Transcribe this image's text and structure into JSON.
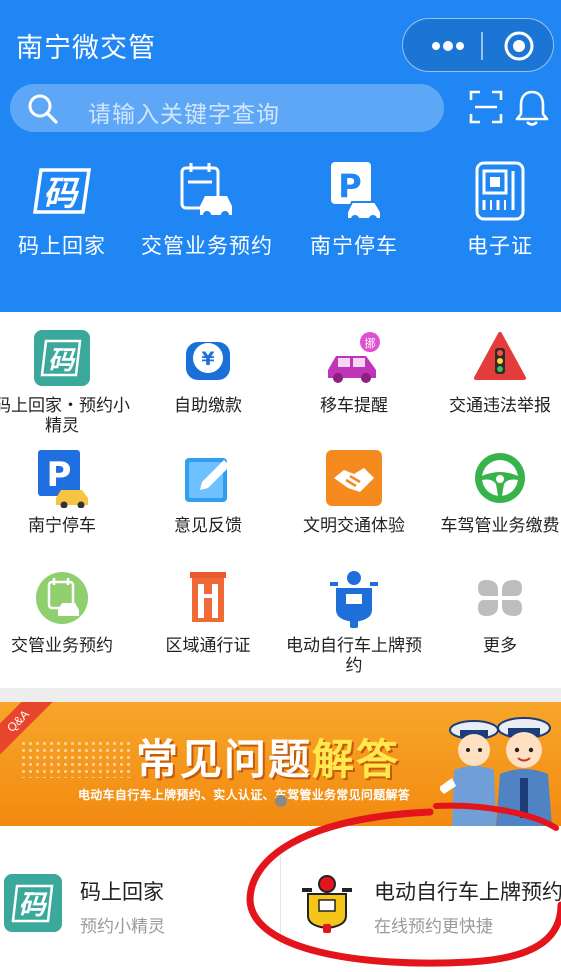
{
  "header": {
    "title": "南宁微交管",
    "search_placeholder": "请输入关键字查询",
    "menu_icon": "more-dots-icon",
    "close_icon": "target-circle-icon"
  },
  "quick_actions": [
    {
      "label": "码上回家",
      "icon": "mashang-logo-icon"
    },
    {
      "label": "交管业务预约",
      "icon": "calendar-car-icon"
    },
    {
      "label": "南宁停车",
      "icon": "parking-car-icon"
    },
    {
      "label": "电子证",
      "icon": "digital-card-icon"
    }
  ],
  "services": [
    {
      "label": "码上回家・预约小精灵",
      "icon": "mashang-logo-icon"
    },
    {
      "label": "自助缴款",
      "icon": "yuan-wallet-icon"
    },
    {
      "label": "移车提醒",
      "icon": "move-car-icon"
    },
    {
      "label": "交通违法举报",
      "icon": "traffic-light-icon"
    },
    {
      "label": "南宁停车",
      "icon": "parking-icon"
    },
    {
      "label": "意见反馈",
      "icon": "edit-pen-icon"
    },
    {
      "label": "文明交通体验",
      "icon": "handshake-icon"
    },
    {
      "label": "车驾管业务缴费",
      "icon": "steering-wheel-icon"
    },
    {
      "label": "交管业务预约",
      "icon": "calendar-car-icon"
    },
    {
      "label": "区域通行证",
      "icon": "gate-pass-icon"
    },
    {
      "label": "电动自行车上牌预约",
      "icon": "ebike-plate-icon"
    },
    {
      "label": "更多",
      "icon": "more-grid-icon"
    }
  ],
  "banner": {
    "tag": "Q&A",
    "title_white": "常见问题",
    "title_yellow": "解答",
    "subtitle": "电动车自行车上牌预约、实人认证、车驾管业务常见问题解答"
  },
  "cards": [
    {
      "title": "码上回家",
      "subtitle": "预约小精灵",
      "icon": "mashang-logo-icon"
    },
    {
      "title": "电动自行车上牌预约",
      "subtitle": "在线预约更快捷",
      "icon": "ebike-plate-icon"
    }
  ],
  "colors": {
    "header_blue": "#1f86f3",
    "banner_orange": "#f28a10",
    "teal": "#3aa89a",
    "annotation_red": "#e3141b"
  }
}
